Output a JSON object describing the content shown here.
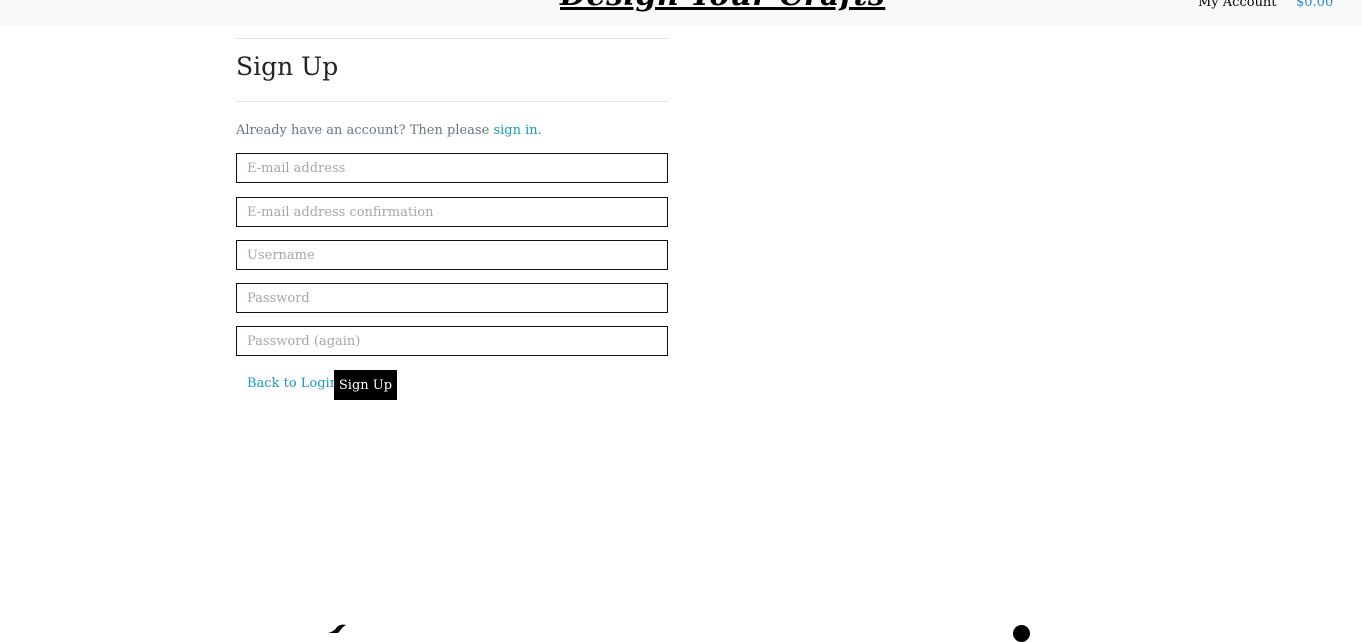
{
  "header": {
    "logo_text": "Design Your Crafts",
    "my_account_label": "My Account",
    "cart_total": "$0.00"
  },
  "main": {
    "title": "Sign Up",
    "signin_prompt": "Already have an account? Then please ",
    "signin_link": "sign in.",
    "fields": {
      "email": {
        "placeholder": "E-mail address",
        "value": ""
      },
      "email_confirm": {
        "placeholder": "E-mail address confirmation",
        "value": ""
      },
      "username": {
        "placeholder": "Username",
        "value": ""
      },
      "password": {
        "placeholder": "Password",
        "value": ""
      },
      "password_again": {
        "placeholder": "Password (again)",
        "value": ""
      }
    },
    "back_to_login_label": "Back to Login",
    "signup_button_label": "Sign Up"
  },
  "footer": {
    "icons": [
      "twitter-icon",
      "social-icon"
    ]
  },
  "colors": {
    "link": "#1a9bb8",
    "cart": "#2a8ad4",
    "button_bg": "#000000",
    "topbar_bg": "#f8f9fa"
  }
}
